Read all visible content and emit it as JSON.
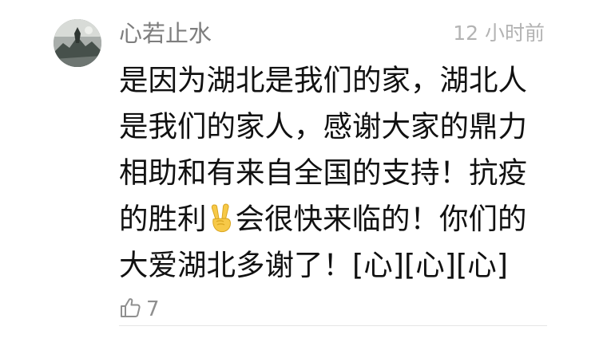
{
  "comment": {
    "author": "心若止水",
    "time": "12 小时前",
    "lines": {
      "l1": "是因为湖北是我们的家，湖北人",
      "l2": "是我们的家人，感谢大家的鼎力",
      "l3": "相助和有来自全国的支持！抗疫",
      "l4_before": "的胜利",
      "l4_emoji_icon": "victory-hand-emoji",
      "l4_after": "会很快来临的！你们的",
      "l5": "大爱湖北多谢了！[心][心][心]"
    },
    "like_count": "7",
    "like_icon": "thumbs-up-outline-icon"
  },
  "colors": {
    "author": "#7d7d7d",
    "time": "#b3b3b3",
    "body_text": "#111111",
    "like": "#8f8f8f",
    "emoji_yellow": "#f7c948"
  }
}
